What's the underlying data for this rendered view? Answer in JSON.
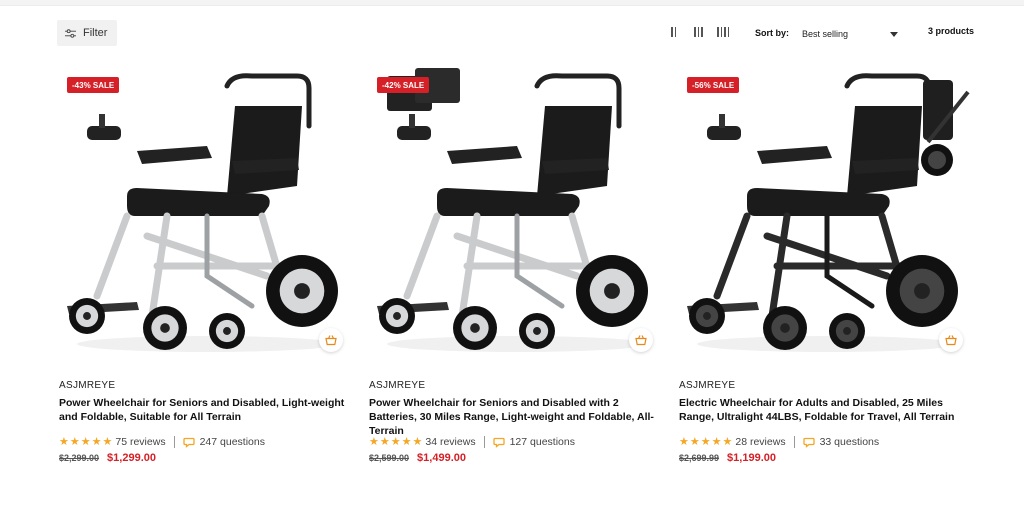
{
  "toolbar": {
    "filter_label": "Filter",
    "sort_label": "Sort by:",
    "sort_value": "Best selling",
    "product_count": "3 products"
  },
  "colors": {
    "sale_red": "#d62027",
    "star_gold": "#f5a623",
    "filter_bg": "#f1f1f1"
  },
  "products": [
    {
      "badge": "-43% SALE",
      "vendor": "ASJMREYE",
      "title": "Power Wheelchair for Seniors and Disabled, Light-weight and Foldable, Suitable for All Terrain",
      "rating": 5,
      "reviews": "75 reviews",
      "questions": "247 questions",
      "compare_price": "$2,299.00",
      "price": "$1,299.00",
      "frame_color": "silver"
    },
    {
      "badge": "-42% SALE",
      "vendor": "ASJMREYE",
      "title": "Power Wheelchair for Seniors and Disabled with 2 Batteries, 30 Miles Range, Light-weight and Foldable, All-Terrain",
      "rating": 5,
      "reviews": "34 reviews",
      "questions": "127 questions",
      "compare_price": "$2,599.00",
      "price": "$1,499.00",
      "frame_color": "silver"
    },
    {
      "badge": "-56% SALE",
      "vendor": "ASJMREYE",
      "title": "Electric Wheelchair for Adults and Disabled, 25 Miles Range, Ultralight 44LBS, Foldable for Travel, All Terrain",
      "rating": 5,
      "reviews": "28 reviews",
      "questions": "33 questions",
      "compare_price": "$2,699.99",
      "price": "$1,199.00",
      "frame_color": "black"
    }
  ],
  "icons": {
    "filter": "sliders-icon",
    "cart": "shopping-basket-icon",
    "questions": "chat-bubble-icon",
    "grid2": "grid-2-columns-icon",
    "grid3": "grid-3-columns-icon",
    "grid4": "grid-4-columns-icon"
  }
}
